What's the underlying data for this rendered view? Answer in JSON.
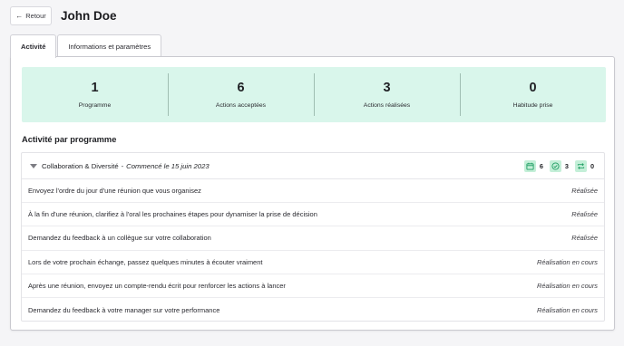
{
  "header": {
    "back_label": "Retour",
    "title": "John Doe"
  },
  "tabs": [
    {
      "label": "Activité",
      "active": true
    },
    {
      "label": "Informations et paramètres",
      "active": false
    }
  ],
  "stats": [
    {
      "value": "1",
      "label": "Programme"
    },
    {
      "value": "6",
      "label": "Actions acceptées"
    },
    {
      "value": "3",
      "label": "Actions réalisées"
    },
    {
      "value": "0",
      "label": "Habitude prise"
    }
  ],
  "section_title": "Activité par programme",
  "program": {
    "name": "Collaboration & Diversité",
    "separator": "-",
    "started": "Commencé le 15 juin 2023",
    "counts": [
      {
        "icon": "calendar-icon",
        "value": "6"
      },
      {
        "icon": "check-circle-icon",
        "value": "3"
      },
      {
        "icon": "repeat-icon",
        "value": "0"
      }
    ],
    "actions": [
      {
        "text": "Envoyez l'ordre du jour d'une réunion que vous organisez",
        "status": "Réalisée"
      },
      {
        "text": "À la fin d'une réunion, clarifiez à l'oral les prochaines étapes pour dynamiser la prise de décision",
        "status": "Réalisée"
      },
      {
        "text": "Demandez du feedback à un collègue sur votre collaboration",
        "status": "Réalisée"
      },
      {
        "text": "Lors de votre prochain échange, passez quelques minutes à écouter vraiment",
        "status": "Réalisation en cours"
      },
      {
        "text": "Après une réunion, envoyez un compte-rendu écrit pour renforcer les actions à lancer",
        "status": "Réalisation en cours"
      },
      {
        "text": "Demandez du feedback à votre manager sur votre performance",
        "status": "Réalisation en cours"
      }
    ]
  },
  "colors": {
    "stats_background": "#d9f6eb",
    "icon_background": "#c4efd8",
    "icon_accent": "#1f9e63"
  }
}
